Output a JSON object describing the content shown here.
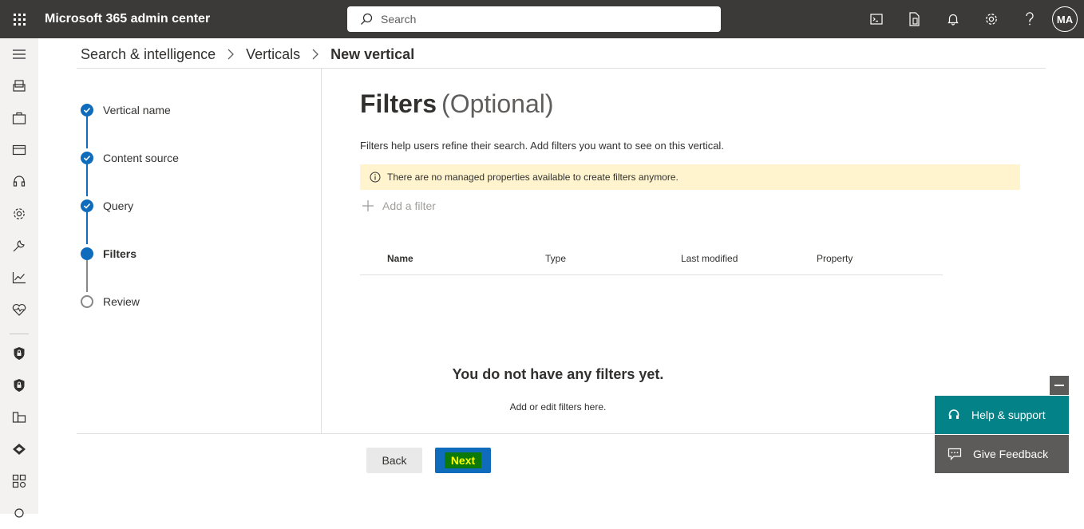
{
  "header": {
    "app_title": "Microsoft 365 admin center",
    "search_placeholder": "Search",
    "avatar_initials": "MA",
    "icons": [
      "terminal-icon",
      "document-phone-icon",
      "bell-icon",
      "gear-icon",
      "help-icon"
    ]
  },
  "leftnav": {
    "icons": [
      "menu-icon",
      "users-icon",
      "briefcase-icon",
      "billing-card-icon",
      "headset-icon",
      "settings-icon",
      "wrench-icon",
      "chart-icon",
      "health-icon",
      "shield-lock-icon",
      "shield-lock-icon-2",
      "org-icon",
      "diamond-icon",
      "apps-icon",
      "more-icon"
    ]
  },
  "breadcrumb": {
    "items": [
      "Search & intelligence",
      "Verticals"
    ],
    "current": "New vertical"
  },
  "wizard": {
    "steps": [
      {
        "label": "Vertical name",
        "state": "done"
      },
      {
        "label": "Content source",
        "state": "done"
      },
      {
        "label": "Query",
        "state": "done"
      },
      {
        "label": "Filters",
        "state": "current"
      },
      {
        "label": "Review",
        "state": "pending"
      }
    ]
  },
  "page": {
    "title": "Filters",
    "title_suffix": "(Optional)",
    "description": "Filters help users refine their search. Add filters you want to see on this vertical.",
    "banner": "There are no managed properties available to create filters anymore.",
    "add_filter": "Add a filter",
    "columns": [
      "Name",
      "Type",
      "Last modified",
      "Property"
    ],
    "empty_title": "You do not have any filters yet.",
    "empty_subtitle": "Add or edit filters here."
  },
  "footer": {
    "back_label": "Back",
    "next_label": "Next"
  },
  "support": {
    "help_label": "Help & support",
    "feedback_label": "Give Feedback"
  }
}
